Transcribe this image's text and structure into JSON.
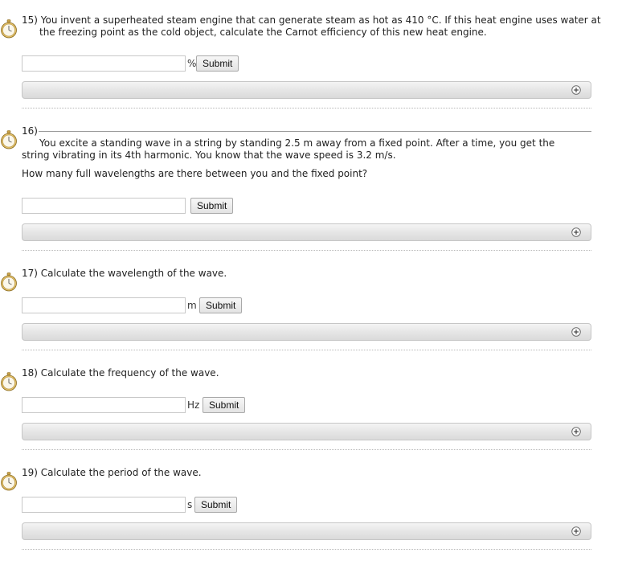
{
  "questions": [
    {
      "number": "15)",
      "text": "You invent a superheated steam engine that can generate steam as hot as 410 °C. If this heat engine uses water at the freezing point as the cold object, calculate the Carnot efficiency of this new heat engine.",
      "unit": "%",
      "input_value": "",
      "submit_label": "Submit"
    },
    {
      "number": "16)",
      "text": "You excite a standing wave in a string by standing 2.5 m away from a fixed point. After a time, you get the string vibrating in its 4th harmonic. You know that the wave speed is 3.2 m/s.",
      "subtext": "How many full wavelengths are there between you and the fixed point?",
      "unit": "",
      "input_value": "",
      "submit_label": "Submit"
    },
    {
      "number": "17)",
      "text": "Calculate the wavelength of the wave.",
      "unit": "m",
      "input_value": "",
      "submit_label": "Submit"
    },
    {
      "number": "18)",
      "text": "Calculate the frequency of the wave.",
      "unit": "Hz",
      "input_value": "",
      "submit_label": "Submit"
    },
    {
      "number": "19)",
      "text": "Calculate the period of the wave.",
      "unit": "s",
      "input_value": "",
      "submit_label": "Submit"
    }
  ],
  "icons": {
    "timer": "stopwatch-icon",
    "expand": "plus-circle-icon"
  },
  "colors": {
    "hint_bar": "#e6e6e6",
    "text": "#222222",
    "input_border": "#c8c8c8"
  }
}
